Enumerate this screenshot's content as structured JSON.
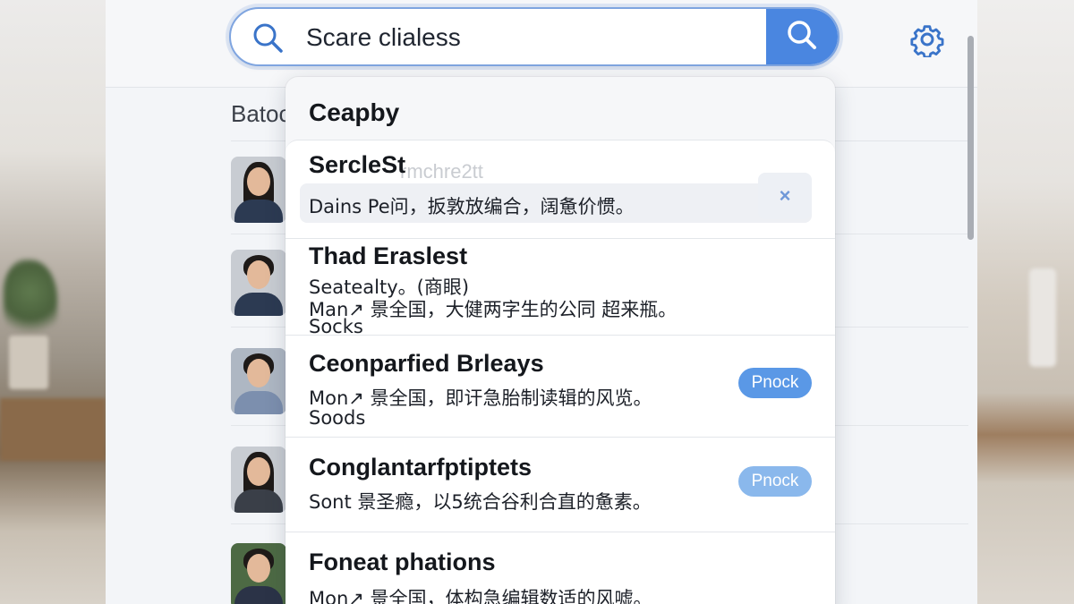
{
  "search": {
    "value": "Scare clialess",
    "placeholder": ""
  },
  "list": {
    "heading": "Batoc"
  },
  "contacts": [
    {
      "avatar": "avatar-woman"
    },
    {
      "avatar": "avatar-man"
    },
    {
      "avatar": "avatar-man"
    },
    {
      "avatar": "avatar-woman"
    },
    {
      "avatar": "avatar-man"
    }
  ],
  "dropdown": {
    "category": "Ceapby",
    "items": [
      {
        "title": "SercleSt",
        "ghost": "rmchre2tt",
        "lines": [
          "Dains Pe问，扳敦放编合，阔惫价惯。"
        ],
        "action": "×"
      },
      {
        "title": "Thad Eraslest",
        "lines": [
          "Seatealty。(商眼)",
          "Man↗ 景全国，大健两字生的公同 超来瓶。",
          "Socks"
        ]
      },
      {
        "title": "Ceonparfied Brleays",
        "lines": [
          "Mon↗ 景全国，即讦急胎制读辑的风览。",
          "Soods"
        ],
        "pill": "Pnock"
      },
      {
        "title": "Conglantarfptiptets",
        "lines": [
          "Sont 景圣瘾，以5统合谷利合直的惫素。"
        ],
        "pill": "Pnock"
      },
      {
        "title": "Foneat phations",
        "lines": [
          "Mon↗ 景全国，体构急编辑数适的风嘘。"
        ]
      }
    ]
  },
  "colors": {
    "accent": "#4a86e0",
    "pill": "#5a98e6",
    "pill_light": "#8ab8ec"
  },
  "icons": {
    "search": "search-icon",
    "settings": "gear-icon",
    "close": "close-icon"
  }
}
